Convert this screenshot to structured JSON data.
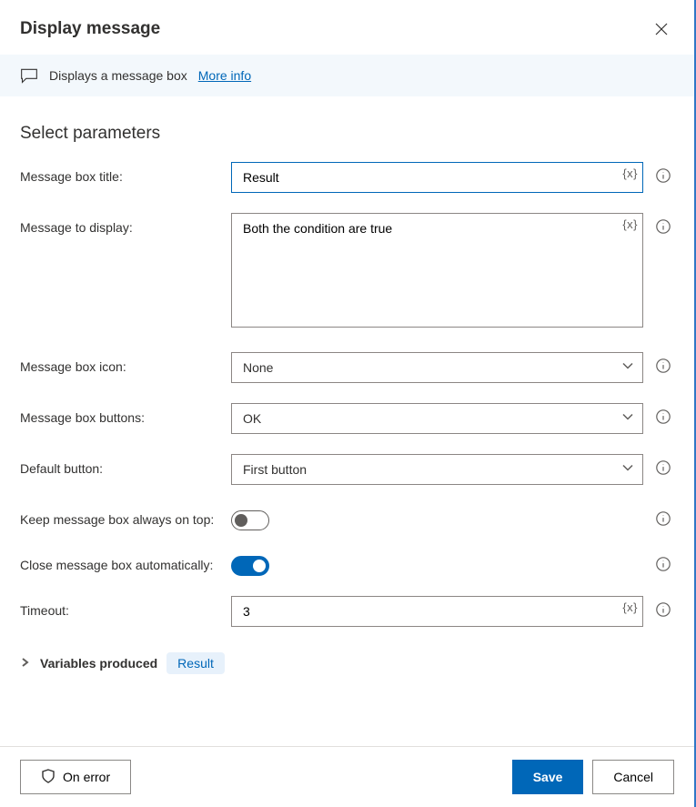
{
  "header": {
    "title": "Display message"
  },
  "banner": {
    "text": "Displays a message box",
    "link": "More info"
  },
  "section_title": "Select parameters",
  "fields": {
    "title_label": "Message box title:",
    "title_value": "Result",
    "msg_label": "Message to display:",
    "msg_value": "Both the condition are true",
    "icon_label": "Message box icon:",
    "icon_value": "None",
    "buttons_label": "Message box buttons:",
    "buttons_value": "OK",
    "default_label": "Default button:",
    "default_value": "First button",
    "ontop_label": "Keep message box always on top:",
    "autoclose_label": "Close message box automatically:",
    "timeout_label": "Timeout:",
    "timeout_value": "3"
  },
  "var_token": "{x}",
  "vars_produced": {
    "label": "Variables produced",
    "chip": "Result"
  },
  "footer": {
    "onerror": "On error",
    "save": "Save",
    "cancel": "Cancel"
  }
}
